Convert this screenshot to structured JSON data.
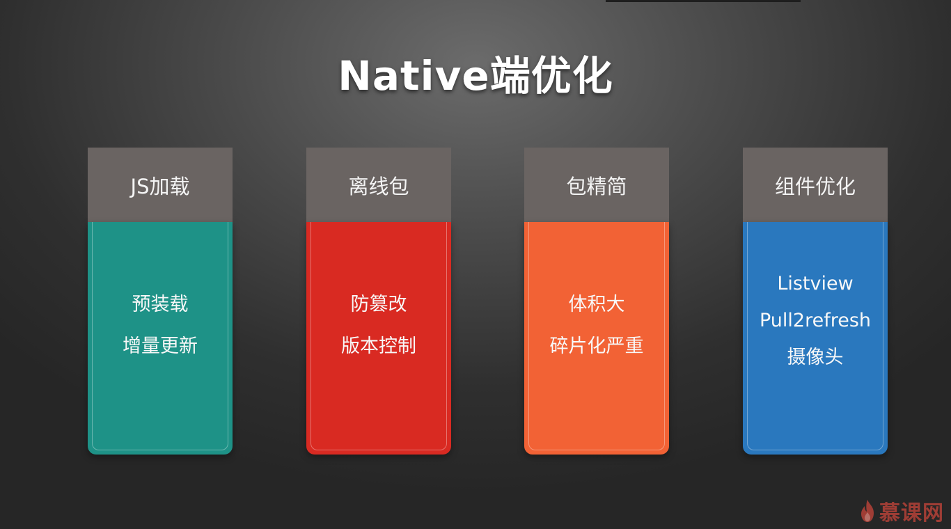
{
  "slide": {
    "title": "Native端优化"
  },
  "cards": [
    {
      "header": "JS加载",
      "color": "#1e9287",
      "items": [
        "预装载",
        "增量更新"
      ]
    },
    {
      "header": "离线包",
      "color": "#d92a22",
      "items": [
        "防篡改",
        "版本控制"
      ]
    },
    {
      "header": "包精简",
      "color": "#f26235",
      "items": [
        "体积大",
        "碎片化严重"
      ]
    },
    {
      "header": "组件优化",
      "color": "#2a78be",
      "items": [
        "Listview",
        "Pull2refresh",
        "摄像头"
      ]
    }
  ],
  "colors": {
    "card_header": "#6a6462",
    "watermark": "#c8453a"
  },
  "watermark": {
    "text": "慕课网",
    "icon": "flame-icon"
  }
}
